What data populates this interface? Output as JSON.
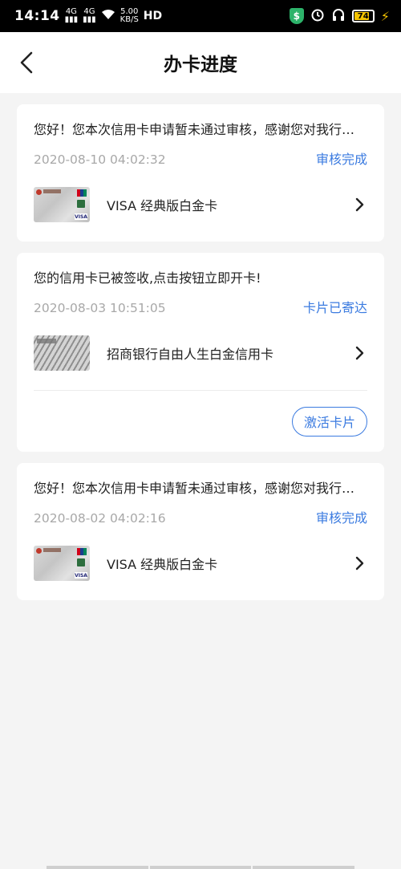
{
  "status_bar": {
    "time": "14:14",
    "net1": "4G",
    "net2": "4G",
    "speed_value": "5.00",
    "speed_unit": "KB/S",
    "hd": "HD",
    "battery": "74"
  },
  "header": {
    "title": "办卡进度"
  },
  "applications": [
    {
      "message": "您好！您本次信用卡申请暂未通过审核，感谢您对我行…",
      "date": "2020-08-10 04:02:32",
      "status": "审核完成",
      "product": "VISA 经典版白金卡"
    },
    {
      "message": "您的信用卡已被签收,点击按钮立即开卡!",
      "date": "2020-08-03 10:51:05",
      "status": "卡片已寄达",
      "product": "招商银行自由人生白金信用卡",
      "action": "激活卡片"
    },
    {
      "message": "您好！您本次信用卡申请暂未通过审核，感谢您对我行…",
      "date": "2020-08-02 04:02:16",
      "status": "审核完成",
      "product": "VISA 经典版白金卡"
    }
  ],
  "colors": {
    "accent": "#3b7be0",
    "background": "#f4f4f4",
    "date_gray": "#a8a8a8"
  }
}
